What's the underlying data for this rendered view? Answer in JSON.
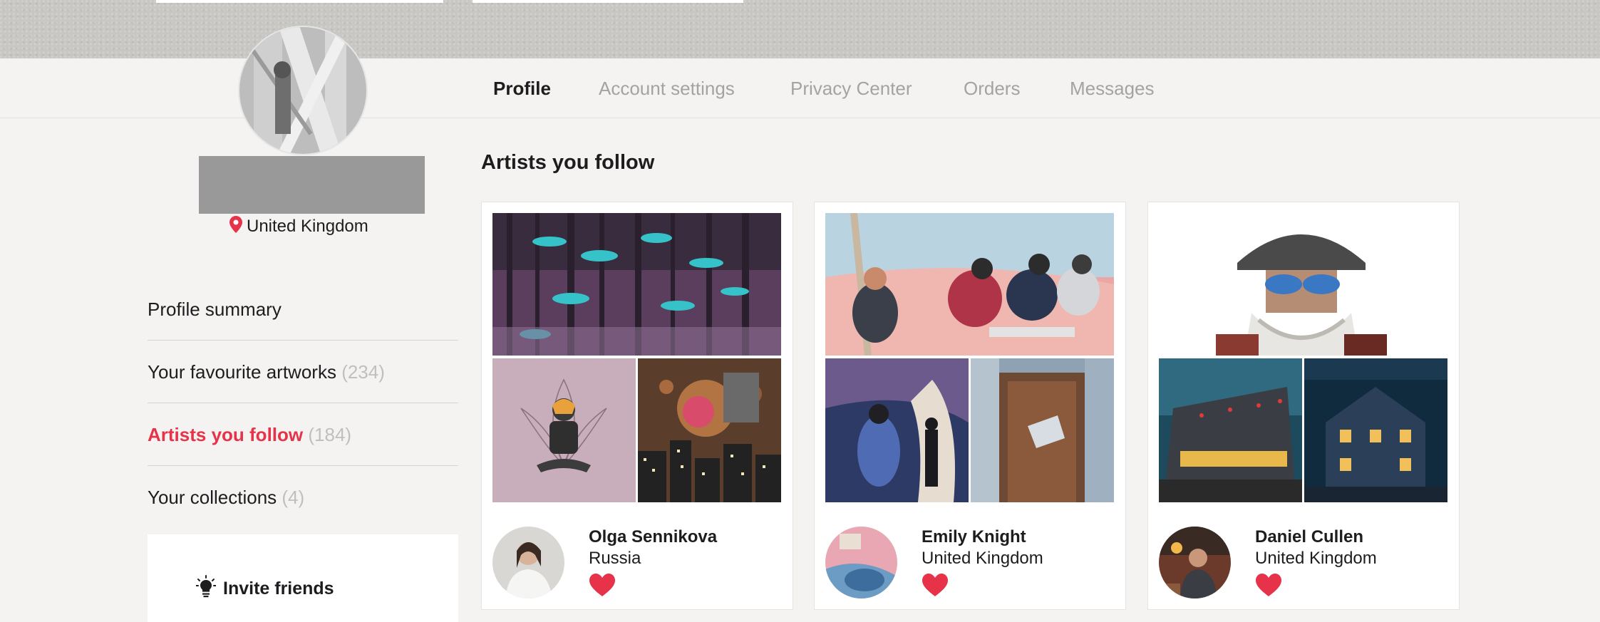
{
  "nav": {
    "tabs": [
      {
        "label": "Profile",
        "active": true
      },
      {
        "label": "Account settings",
        "active": false
      },
      {
        "label": "Privacy Center",
        "active": false
      },
      {
        "label": "Orders",
        "active": false
      },
      {
        "label": "Messages",
        "active": false
      }
    ]
  },
  "profile": {
    "location": "United Kingdom",
    "location_icon": "map-pin-icon"
  },
  "side_menu": {
    "items": [
      {
        "label": "Profile summary",
        "count": ""
      },
      {
        "label": "Your favourite artworks",
        "count": "(234)"
      },
      {
        "label": "Artists you follow",
        "count": "(184)",
        "active": true
      },
      {
        "label": "Your collections",
        "count": "(4)"
      }
    ],
    "invite_label": "Invite friends",
    "invite_icon": "lightbulb-icon"
  },
  "main": {
    "title": "Artists you follow",
    "artists": [
      {
        "name": "Olga Sennikova",
        "country": "Russia"
      },
      {
        "name": "Emily Knight",
        "country": "United Kingdom"
      },
      {
        "name": "Daniel Cullen",
        "country": "United Kingdom"
      }
    ]
  },
  "colors": {
    "accent": "#e6334a",
    "muted": "#a3a3a3",
    "background": "#f4f3f1"
  }
}
